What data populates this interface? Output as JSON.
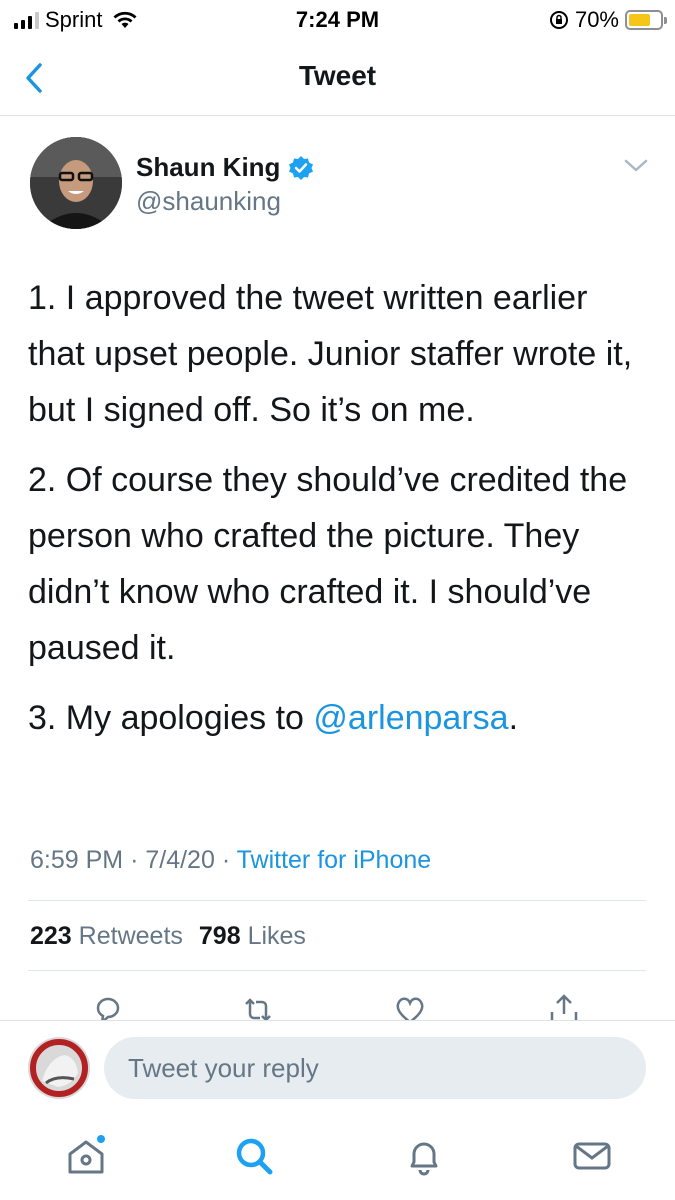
{
  "status_bar": {
    "carrier": "Sprint",
    "time": "7:24 PM",
    "battery": "70%",
    "battery_level": 0.7,
    "icons": [
      "signal-icon",
      "wifi-icon",
      "orientation-lock-icon",
      "battery-icon"
    ]
  },
  "nav": {
    "title": "Tweet",
    "back_icon": "chevron-left-icon"
  },
  "tweet": {
    "author_name": "Shaun King",
    "handle": "@shaunking",
    "paragraphs": [
      "1. I approved the tweet written earlier that upset people. Junior staffer wrote it, but I signed off. So it’s on me.",
      "2. Of course they should’ve credited the person who crafted the picture. They didn’t know who crafted it. I should’ve paused it."
    ],
    "p3_prefix": "3. My apologies to ",
    "p3_mention": "@arlenparsa",
    "p3_suffix": ".",
    "time": "6:59 PM",
    "date": "7/4/20",
    "sep": "·",
    "source": "Twitter for iPhone",
    "retweets_count": "223",
    "retweets_label": "Retweets",
    "likes_count": "798",
    "likes_label": "Likes"
  },
  "reply": {
    "placeholder": "Tweet your reply"
  },
  "tabs": [
    "home-icon",
    "search-icon",
    "notifications-icon",
    "messages-icon"
  ],
  "colors": {
    "accent": "#1b95e0",
    "secondary_text": "#657786",
    "battery": "#f5c518"
  }
}
